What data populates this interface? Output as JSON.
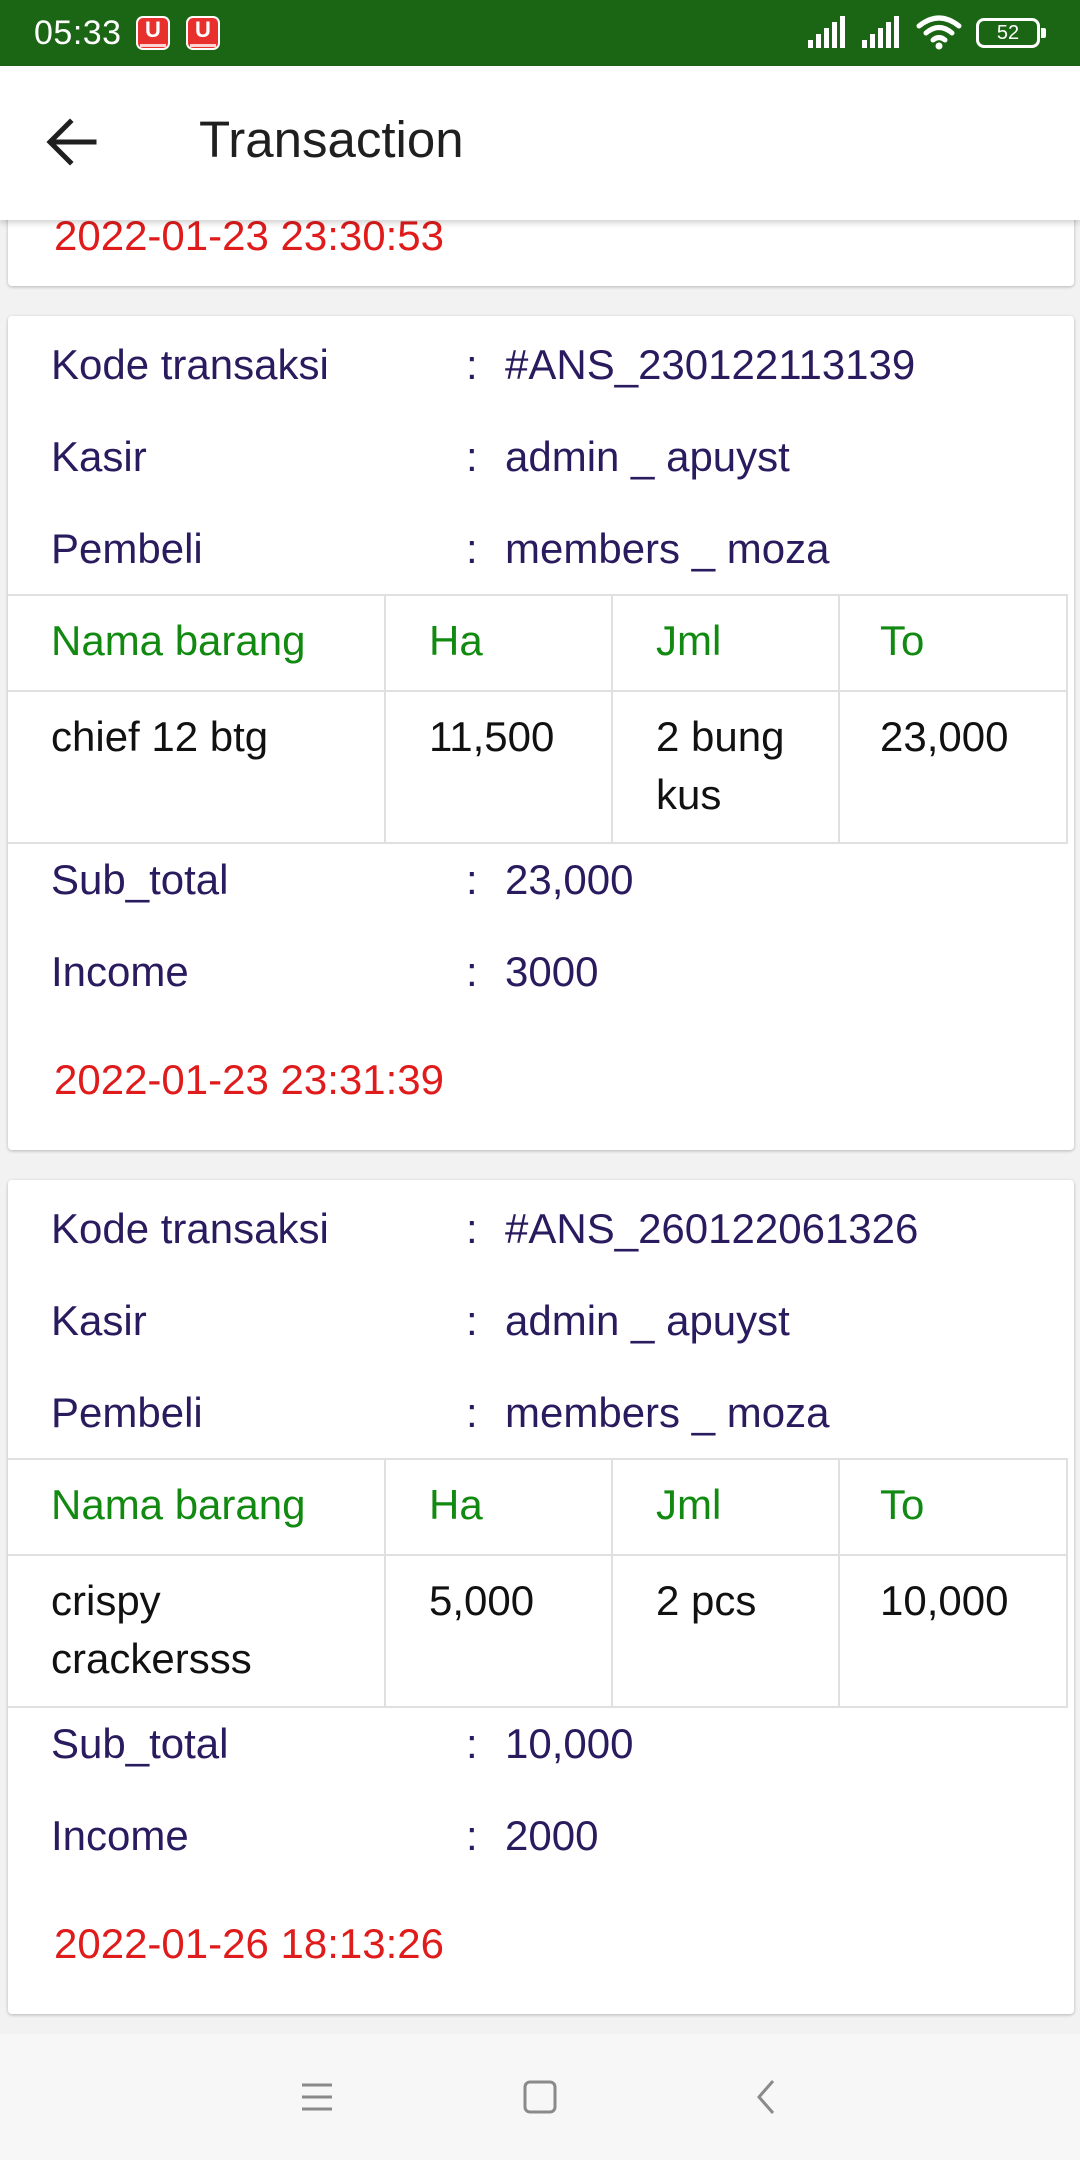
{
  "status_bar": {
    "time": "05:33",
    "notification_badge": "U",
    "battery": "52",
    "background_color": "#1b6614"
  },
  "app_bar": {
    "title": "Transaction",
    "back_icon": "arrow-left-icon"
  },
  "previous_card": {
    "timestamp": "2022-01-23 23:30:53"
  },
  "labels": {
    "kode": "Kode transaksi",
    "kasir": "Kasir",
    "pembeli": "Pembeli",
    "sub_total": "Sub_total",
    "income": "Income",
    "colon": ":"
  },
  "table_headers": [
    "Nama barang",
    "Ha",
    "Jml",
    "To"
  ],
  "transactions": [
    {
      "kode": "#ANS_230122113139",
      "kasir": "admin _ apuyst",
      "pembeli": "members _ moza",
      "items": [
        {
          "nama": "chief 12 btg",
          "harga": "11,500",
          "jml_line1": "2 bung",
          "jml_line2": "kus",
          "total": "23,000"
        }
      ],
      "sub_total": "23,000",
      "income": "3000",
      "timestamp": "2022-01-23 23:31:39"
    },
    {
      "kode": "#ANS_260122061326",
      "kasir": "admin _ apuyst",
      "pembeli": "members _ moza",
      "items": [
        {
          "nama_line1": "crispy",
          "nama_line2": "crackersss",
          "harga": "5,000",
          "jml": "2 pcs",
          "total": "10,000"
        }
      ],
      "sub_total": "10,000",
      "income": "2000",
      "timestamp": "2022-01-26 18:13:26"
    }
  ],
  "colors": {
    "label_text": "#2a1a5e",
    "header_text": "#128a12",
    "timestamp_text": "#e01b1b"
  },
  "nav_bar": {
    "icons": [
      "menu-icon",
      "home-square-icon",
      "back-chevron-icon"
    ]
  }
}
